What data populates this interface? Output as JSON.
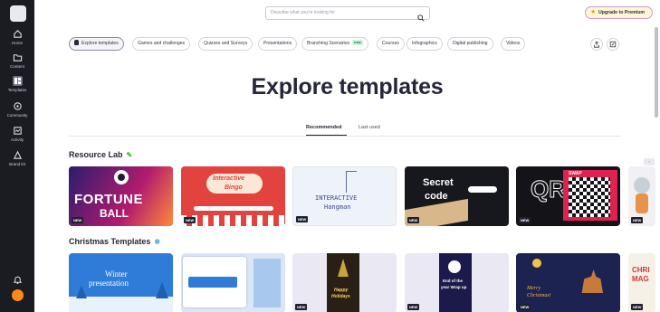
{
  "sidebar": {
    "items": [
      {
        "label": "Home",
        "icon": "home-icon"
      },
      {
        "label": "Content",
        "icon": "folder-icon"
      },
      {
        "label": "Templates",
        "icon": "templates-icon"
      },
      {
        "label": "Community",
        "icon": "community-icon"
      },
      {
        "label": "Activity",
        "icon": "activity-icon"
      },
      {
        "label": "Brand kit",
        "icon": "brand-kit-icon"
      }
    ]
  },
  "search": {
    "placeholder": "Describe what you're looking for"
  },
  "header": {
    "premium_label": "Upgrade to Premium"
  },
  "categories": [
    {
      "label": "Explore templates"
    },
    {
      "label": "Games and challenges"
    },
    {
      "label": "Quizzes and Surveys"
    },
    {
      "label": "Presentations"
    },
    {
      "label": "Branching Scenarios",
      "badge": "new"
    },
    {
      "label": "Courses"
    },
    {
      "label": "Infographics"
    },
    {
      "label": "Digital publishing"
    },
    {
      "label": "Videos"
    }
  ],
  "main": {
    "title": "Explore templates",
    "tabs": [
      {
        "label": "Recommended"
      },
      {
        "label": "Last used"
      }
    ]
  },
  "sections": [
    {
      "title": "Resource Lab",
      "cards": [
        {
          "lines": [
            "FORTUNE",
            "BALL"
          ],
          "badge": "NEW"
        },
        {
          "lines": [
            "Interactive",
            "Bingo"
          ],
          "badge": "NEW"
        },
        {
          "lines": [
            "INTERACTIVE",
            "Hangman"
          ],
          "badge": "NEW"
        },
        {
          "lines": [
            "Secret",
            "code"
          ],
          "badge": "NEW"
        },
        {
          "lines": [
            "QR",
            "SWAP"
          ],
          "badge": "NEW"
        },
        {
          "lines": [],
          "badge": "NEW"
        }
      ]
    },
    {
      "title": "Christmas Templates",
      "cards": [
        {
          "lines": [
            "Winter",
            "presentation"
          ],
          "badge": ""
        },
        {
          "lines": [],
          "badge": ""
        },
        {
          "lines": [
            "Happy",
            "Holidays"
          ],
          "badge": "NEW"
        },
        {
          "lines": [
            "End of the",
            "year Wrap up"
          ],
          "badge": "NEW"
        },
        {
          "lines": [
            "Merry",
            "Christmas!"
          ],
          "badge": "NEW"
        },
        {
          "lines": [
            "CHRI",
            "MAG"
          ],
          "badge": "NEW"
        }
      ]
    }
  ],
  "colors": {
    "sidebar": "#1b1b22",
    "accent_yellow": "#fff6d6",
    "premium_border": "#c89bd4",
    "new_badge_bg": "#c6f4dc"
  }
}
